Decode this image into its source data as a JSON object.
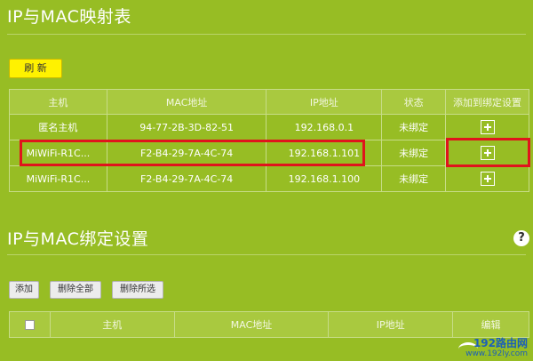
{
  "section1": {
    "title": "IP与MAC映射表",
    "refresh_label": "刷 新",
    "columns": [
      "主机",
      "MAC地址",
      "IP地址",
      "状态",
      "添加到绑定设置"
    ],
    "rows": [
      {
        "host": "匿名主机",
        "mac": "94-77-2B-3D-82-51",
        "ip": "192.168.0.1",
        "status": "未绑定"
      },
      {
        "host": "MiWiFi-R1C...",
        "mac": "F2-B4-29-7A-4C-74",
        "ip": "192.168.1.101",
        "status": "未绑定"
      },
      {
        "host": "MiWiFi-R1C...",
        "mac": "F2-B4-29-7A-4C-74",
        "ip": "192.168.1.100",
        "status": "未绑定"
      }
    ]
  },
  "section2": {
    "title": "IP与MAC绑定设置",
    "help_label": "?",
    "add_label": "添加",
    "delete_all_label": "删除全部",
    "delete_selected_label": "删除所选",
    "columns": [
      "主机",
      "MAC地址",
      "IP地址",
      "编辑"
    ]
  },
  "watermark": {
    "main": "192路由网",
    "sub": "www.192ly.com"
  },
  "colors": {
    "background": "#97bd24",
    "refresh_button": "#fff200",
    "highlight": "#e0141c"
  },
  "icons": [
    "plus-icon",
    "help-icon",
    "checkbox"
  ]
}
